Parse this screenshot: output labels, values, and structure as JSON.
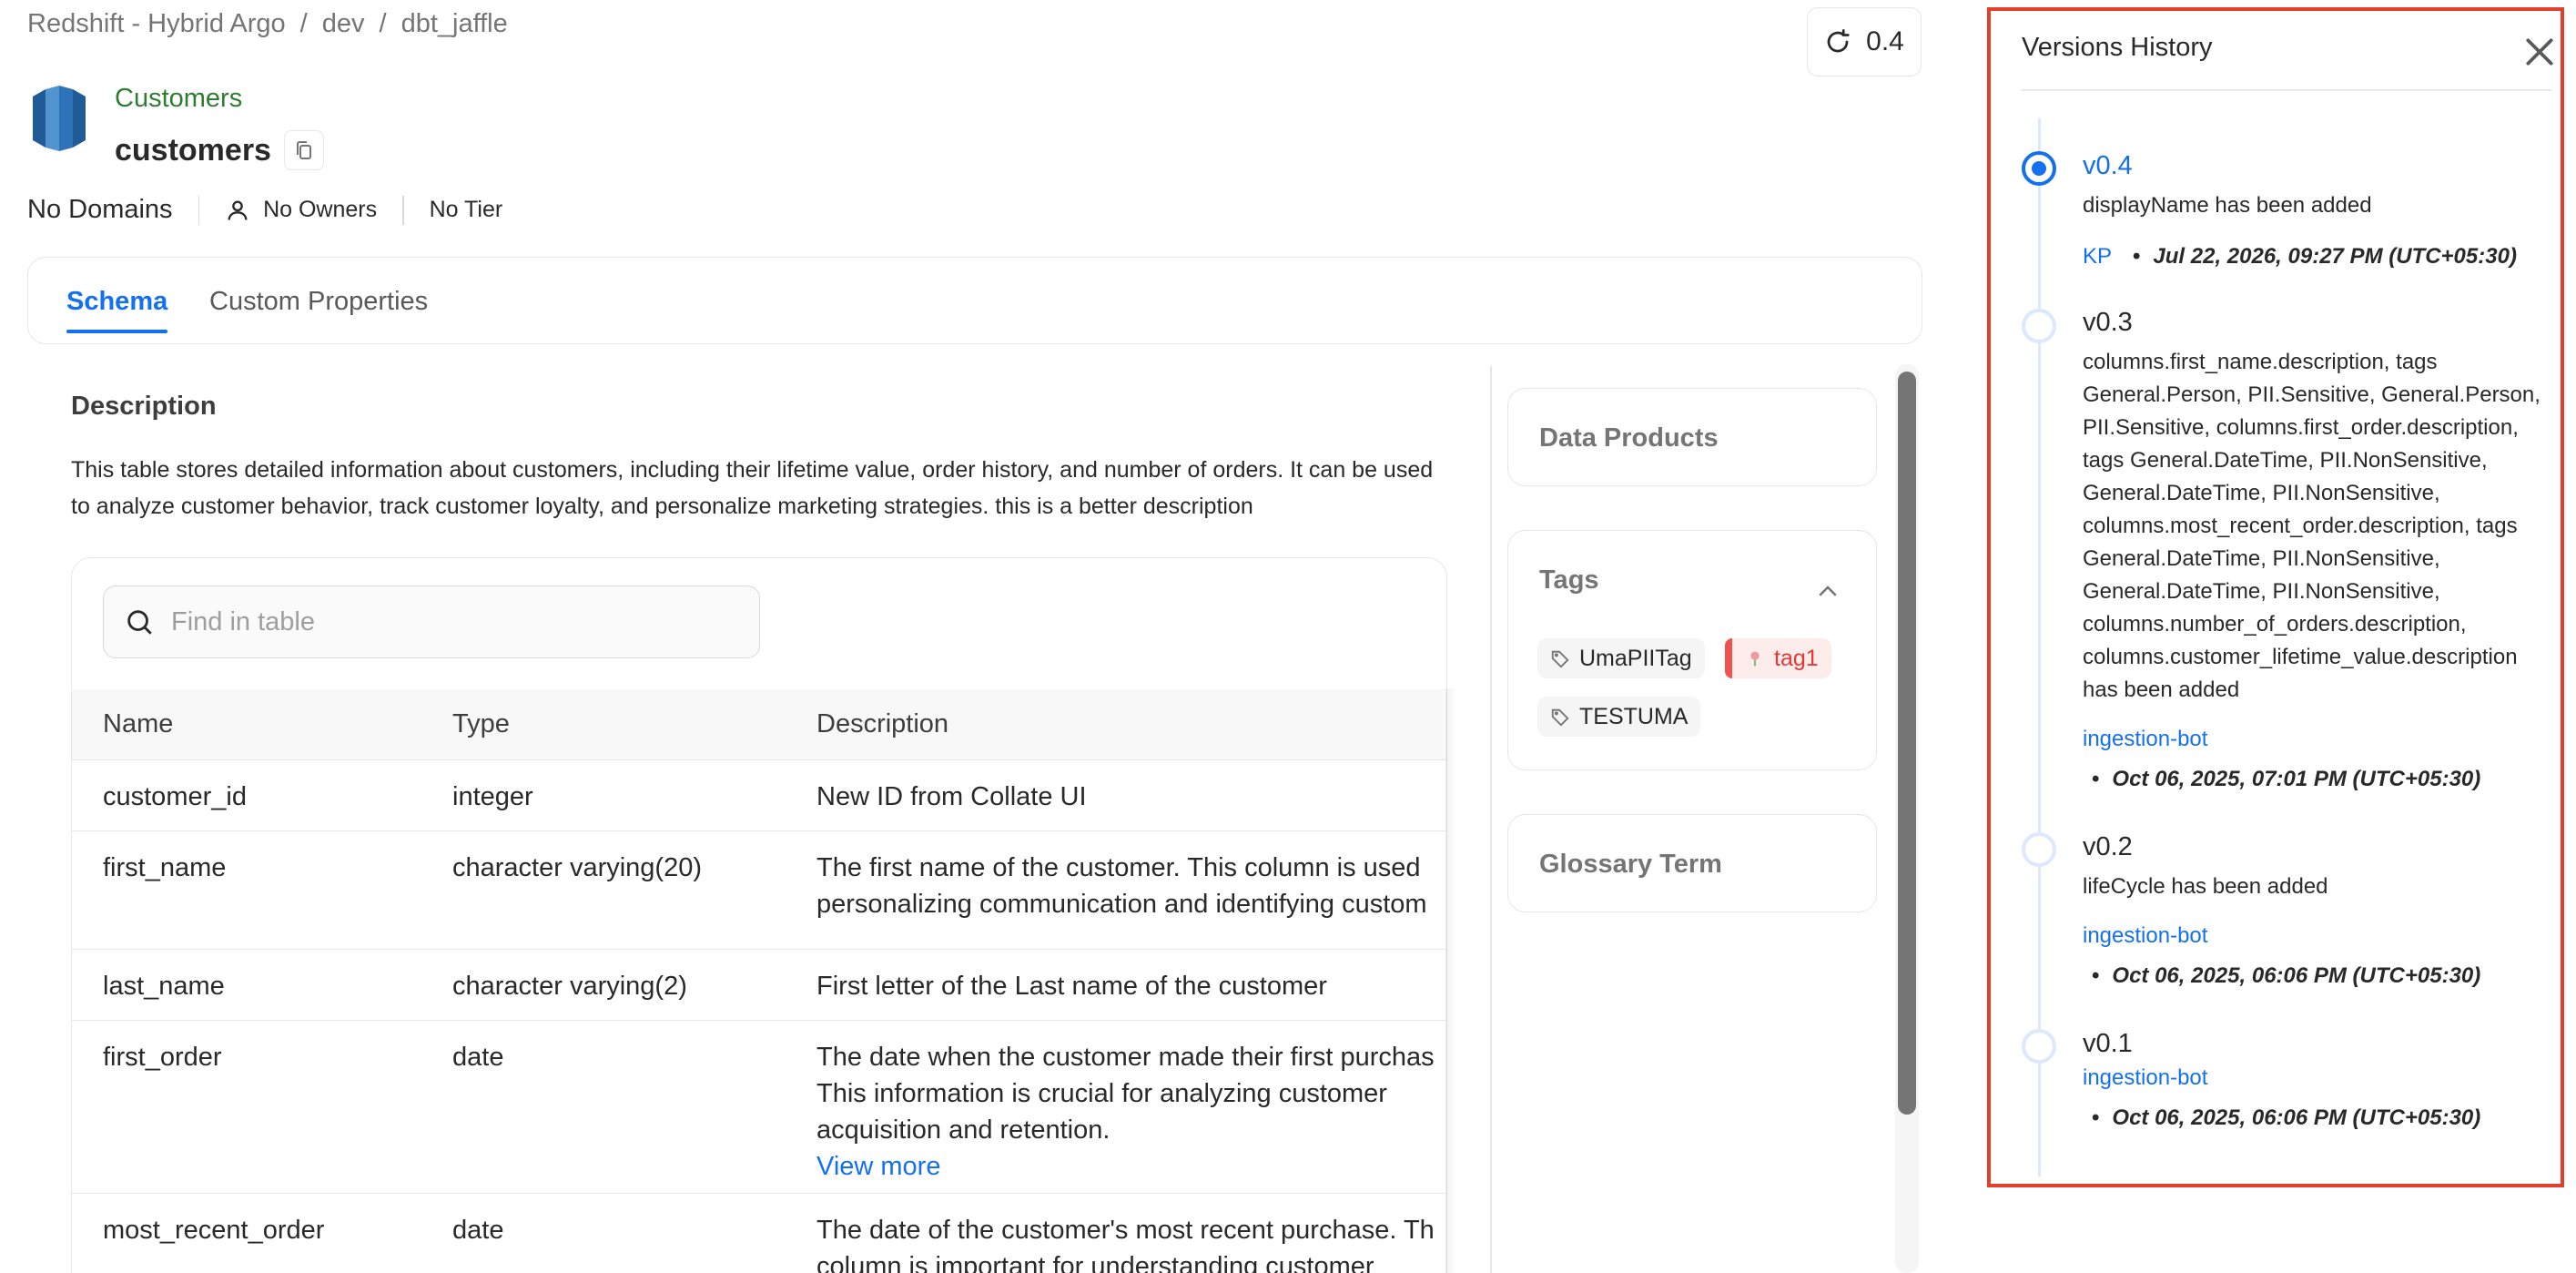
{
  "breadcrumb": [
    "Redshift - Hybrid Argo",
    "dev",
    "dbt_jaffle"
  ],
  "version_button": "0.4",
  "entity": {
    "display_name": "Customers",
    "name": "customers"
  },
  "meta": {
    "domains": "No Domains",
    "owners": "No Owners",
    "tier": "No Tier"
  },
  "tabs": [
    {
      "label": "Schema",
      "active": true
    },
    {
      "label": "Custom Properties",
      "active": false
    }
  ],
  "description": {
    "title": "Description",
    "text": "This table stores detailed information about customers, including their lifetime value, order history, and number of orders. It can be used to analyze customer behavior, track customer loyalty, and personalize marketing strategies. this is a better description"
  },
  "table": {
    "search_placeholder": "Find in table",
    "columns": [
      "Name",
      "Type",
      "Description"
    ],
    "rows": [
      {
        "name": "customer_id",
        "type": "integer",
        "desc": [
          "New ID from Collate UI"
        ]
      },
      {
        "name": "first_name",
        "type": "character varying(20)",
        "desc": [
          "The first name of the customer. This column is used",
          "personalizing communication and identifying custom"
        ]
      },
      {
        "name": "last_name",
        "type": "character varying(2)",
        "desc": [
          "First letter of the Last name of the customer"
        ]
      },
      {
        "name": "first_order",
        "type": "date",
        "desc": [
          "The date when the customer made their first purchas",
          "This information is crucial for analyzing customer",
          "acquisition and retention."
        ],
        "view_more": "View more"
      },
      {
        "name": "most_recent_order",
        "type": "date",
        "desc": [
          "The date of the customer's most recent purchase. Th",
          "column is important for understanding customer"
        ]
      }
    ]
  },
  "side_panels": {
    "data_products": "Data Products",
    "tags_title": "Tags",
    "tags": [
      "UmaPIITag",
      "tag1",
      "TESTUMA"
    ],
    "glossary": "Glossary Term"
  },
  "versions": {
    "title": "Versions History",
    "items": [
      {
        "version": "v0.4",
        "desc": "displayName has been added",
        "author": "KP",
        "time": "Jul 22, 2026, 09:27 PM (UTC+05:30)",
        "active": true
      },
      {
        "version": "v0.3",
        "desc": "columns.first_name.description, tags General.Person, PII.Sensitive, General.Person, PII.Sensitive, columns.first_order.description, tags General.DateTime, PII.NonSensitive, General.DateTime, PII.NonSensitive, columns.most_recent_order.description, tags General.DateTime, PII.NonSensitive, General.DateTime, PII.NonSensitive, columns.number_of_orders.description, columns.customer_lifetime_value.description has been added",
        "author": "ingestion-bot",
        "time": "Oct 06, 2025, 07:01 PM (UTC+05:30)",
        "active": false
      },
      {
        "version": "v0.2",
        "desc": "lifeCycle has been added",
        "author": "ingestion-bot",
        "time": "Oct 06, 2025, 06:06 PM (UTC+05:30)",
        "active": false
      },
      {
        "version": "v0.1",
        "desc": "",
        "author": "ingestion-bot",
        "time": "Oct 06, 2025, 06:06 PM (UTC+05:30)",
        "active": false
      }
    ]
  },
  "colors": {
    "accent": "#1470ef",
    "highlight_border": "#e53e2a",
    "display_name": "#2e7d32"
  }
}
